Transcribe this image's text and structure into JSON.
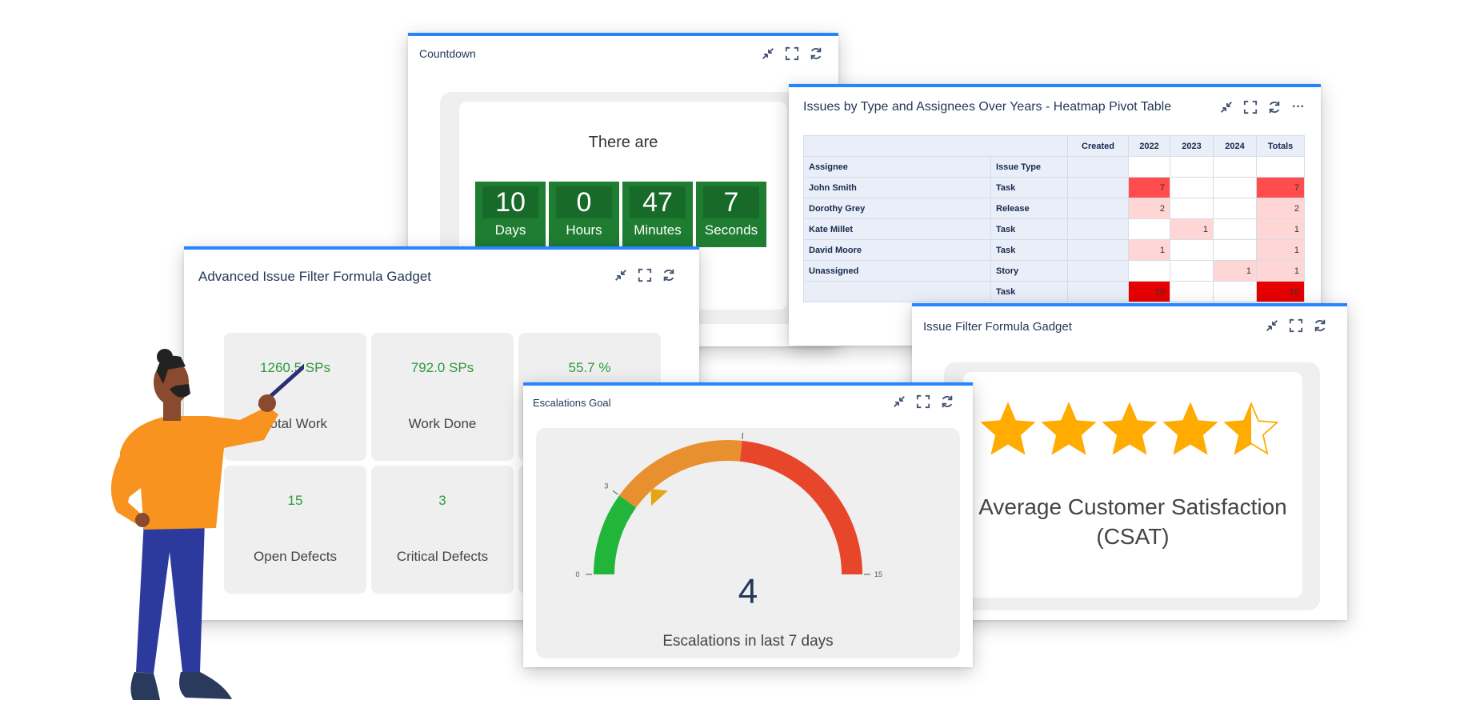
{
  "colors": {
    "accent": "#2684ff",
    "countdown_green": "#1f7d32",
    "tile_value_green": "#2e9a3e",
    "gauge_green": "#21b63a",
    "gauge_orange": "#e8902f",
    "gauge_red": "#e8462b",
    "pointer": "#e6a312",
    "star": "#ffab00",
    "heat_strong": "#ff4d4d",
    "heat_light": "#ffd6d6",
    "heat_max": "#e60000"
  },
  "icons": [
    "collapse-icon",
    "fullscreen-icon",
    "refresh-icon",
    "more-icon",
    "star-icon"
  ],
  "countdown": {
    "title": "Countdown",
    "lead": "There are",
    "units": [
      {
        "value": "10",
        "label": "Days"
      },
      {
        "value": "0",
        "label": "Hours"
      },
      {
        "value": "47",
        "label": "Minutes"
      },
      {
        "value": "7",
        "label": "Seconds"
      }
    ]
  },
  "heatmap": {
    "title": "Issues by Type and Assignees Over Years - Heatmap Pivot Table",
    "more_label": "···",
    "header_created": "Created",
    "years": [
      "2022",
      "2023",
      "2024"
    ],
    "totals_label": "Totals",
    "col_assignee": "Assignee",
    "col_issue_type": "Issue Type",
    "rows": [
      {
        "assignee": "John Smith",
        "type": "Task",
        "cells": [
          "7",
          "",
          ""
        ],
        "total": "7"
      },
      {
        "assignee": "Dorothy Grey",
        "type": "Release",
        "cells": [
          "2",
          "",
          ""
        ],
        "total": "2"
      },
      {
        "assignee": "Kate Millet",
        "type": "Task",
        "cells": [
          "",
          "1",
          ""
        ],
        "total": "1"
      },
      {
        "assignee": "David Moore",
        "type": "Task",
        "cells": [
          "1",
          "",
          ""
        ],
        "total": "1"
      },
      {
        "assignee": "Unassigned",
        "type": "Story",
        "cells": [
          "",
          "",
          "1"
        ],
        "total": "1"
      },
      {
        "assignee": "",
        "type": "Task",
        "cells": [
          "10",
          "",
          ""
        ],
        "total": "10"
      }
    ]
  },
  "advanced": {
    "title": "Advanced Issue Filter Formula Gadget",
    "tiles": [
      {
        "value": "1260.5 SPs",
        "label": "Total Work"
      },
      {
        "value": "792.0 SPs",
        "label": "Work Done"
      },
      {
        "value": "55.7 %",
        "label": ""
      },
      {
        "value": "15",
        "label": "Open Defects"
      },
      {
        "value": "3",
        "label": "Critical Defects"
      }
    ]
  },
  "csat": {
    "title": "Issue Filter Formula Gadget",
    "rating": 4.5,
    "max_rating": 5,
    "line1": "Average Customer Satisfaction",
    "line2": "(CSAT)"
  },
  "escalations": {
    "title": "Escalations Goal",
    "value": "4",
    "caption": "Escalations in last 7 days",
    "min": 0,
    "max": 15,
    "thresholds": [
      3,
      8
    ],
    "ticks": [
      "0",
      "3",
      "8",
      "15"
    ]
  }
}
